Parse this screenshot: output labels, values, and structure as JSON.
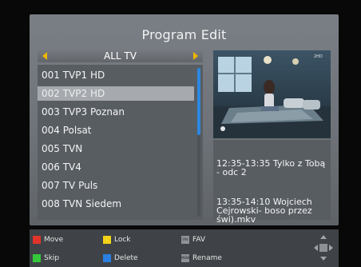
{
  "title": "Program Edit",
  "group": {
    "label": "ALL TV"
  },
  "channels": [
    "001 TVP1 HD",
    "002 TVP2 HD",
    "003 TVP3 Poznan",
    "004 Polsat",
    "005 TVN",
    "006 TV4",
    "007 TV Puls",
    "008 TVN Siedem"
  ],
  "selected_index": 1,
  "scroll_fraction": 0.45,
  "epg": {
    "now": "12:35-13:35  Tylko z Tobą - odc 2",
    "next": "13:35-14:10  Wojciech Cejrowski- boso przez świ).mkv"
  },
  "hints": {
    "move": "Move",
    "lock": "Lock",
    "fav": "FAV",
    "skip": "Skip",
    "delete": "Delete",
    "rename": "Rename"
  },
  "colors": {
    "red": "#e0342a",
    "yellow": "#f2d21a",
    "green": "#35c83a",
    "blue": "#2a7fe0",
    "selection": "#a6aaaf",
    "accent": "#f0b400"
  },
  "icons": {
    "left": "arrow-left",
    "right": "arrow-right",
    "nav": "dpad"
  }
}
